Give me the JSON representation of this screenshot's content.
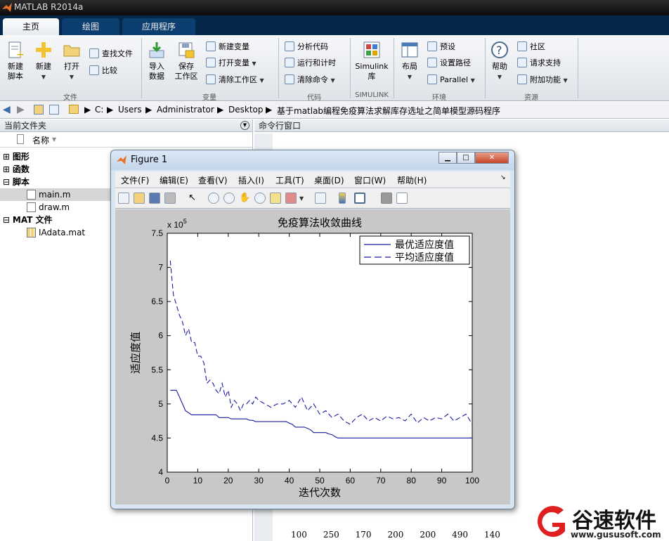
{
  "app": {
    "title": "MATLAB R2014a"
  },
  "tabs": [
    {
      "label": "主页"
    },
    {
      "label": "绘图"
    },
    {
      "label": "应用程序"
    }
  ],
  "ribbon": {
    "file": {
      "new_script": "新建\n脚本",
      "new": "新建",
      "open": "打开",
      "find_files": "查找文件",
      "compare": "比较",
      "group": "文件"
    },
    "variable": {
      "import": "导入\n数据",
      "save_ws": "保存\n工作区",
      "new_var": "新建变量",
      "open_var": "打开变量",
      "clear_ws": "清除工作区",
      "group": "变量"
    },
    "code": {
      "analyze": "分析代码",
      "run_time": "运行和计时",
      "clear_cmd": "清除命令",
      "group": "代码"
    },
    "simulink": {
      "label": "Simulink\n库",
      "group": "SIMULINK"
    },
    "env": {
      "layout": "布局",
      "prefs": "预设",
      "set_path": "设置路径",
      "parallel": "Parallel",
      "group": "环境"
    },
    "resources": {
      "help": "帮助",
      "community": "社区",
      "support": "请求支持",
      "addons": "附加功能",
      "group": "资源"
    }
  },
  "address": {
    "parts": [
      "C:",
      "Users",
      "Administrator",
      "Desktop",
      "基于matlab编程免疫算法求解库存选址之简单模型源码程序"
    ]
  },
  "left_panel": {
    "title": "当前文件夹",
    "col_name": "名称",
    "tree": [
      {
        "label": "图形"
      },
      {
        "label": "函数"
      },
      {
        "label": "脚本"
      },
      {
        "label": "main.m"
      },
      {
        "label": "draw.m"
      },
      {
        "label": "MAT 文件"
      },
      {
        "label": "IAdata.mat"
      }
    ]
  },
  "right_panel": {
    "title": "命令行窗口",
    "bottom_numbers": [
      "100",
      "250",
      "170",
      "200",
      "200",
      "490",
      "140"
    ]
  },
  "figure": {
    "title": "Figure 1",
    "menu": [
      "文件(F)",
      "编辑(E)",
      "查看(V)",
      "插入(I)",
      "工具(T)",
      "桌面(D)",
      "窗口(W)",
      "帮助(H)"
    ]
  },
  "watermark": {
    "text": "谷速软件",
    "url": "www.gususoft.com"
  },
  "chart_data": {
    "type": "line",
    "title": "免疫算法收敛曲线",
    "xlabel": "迭代次数",
    "ylabel": "适应度值",
    "y_exponent": "x 10^5",
    "xlim": [
      0,
      100
    ],
    "ylim": [
      4,
      7.5
    ],
    "x_ticks": [
      "0",
      "10",
      "20",
      "30",
      "40",
      "50",
      "60",
      "70",
      "80",
      "90",
      "100"
    ],
    "y_ticks": [
      "4",
      "4.5",
      "5",
      "5.5",
      "6",
      "6.5",
      "7",
      "7.5"
    ],
    "legend_position": "top-right",
    "series": [
      {
        "name": "最优适应度值",
        "style": "solid",
        "color": "#1a1aa0",
        "x": [
          1,
          3,
          4,
          5,
          6,
          8,
          10,
          11,
          12,
          13,
          14,
          15,
          16,
          17,
          18,
          19,
          20,
          21,
          22,
          23,
          24,
          25,
          26,
          27,
          28,
          29,
          30,
          31,
          32,
          33,
          34,
          35,
          36,
          37,
          38,
          39,
          40,
          41,
          42,
          43,
          44,
          45,
          46,
          47,
          48,
          49,
          50,
          51,
          52,
          53,
          54,
          55,
          56,
          57,
          58,
          59,
          60,
          65,
          70,
          75,
          80,
          85,
          90,
          95,
          100
        ],
        "y": [
          5.2,
          5.2,
          5.1,
          5.0,
          4.9,
          4.84,
          4.84,
          4.84,
          4.84,
          4.84,
          4.84,
          4.84,
          4.84,
          4.8,
          4.8,
          4.8,
          4.8,
          4.78,
          4.78,
          4.78,
          4.78,
          4.78,
          4.78,
          4.76,
          4.76,
          4.74,
          4.74,
          4.74,
          4.74,
          4.74,
          4.74,
          4.74,
          4.74,
          4.74,
          4.74,
          4.74,
          4.72,
          4.7,
          4.66,
          4.66,
          4.66,
          4.66,
          4.64,
          4.62,
          4.58,
          4.58,
          4.58,
          4.58,
          4.58,
          4.56,
          4.55,
          4.52,
          4.5,
          4.5,
          4.5,
          4.5,
          4.5,
          4.5,
          4.5,
          4.5,
          4.5,
          4.5,
          4.5,
          4.5,
          4.5
        ]
      },
      {
        "name": "平均适应度值",
        "style": "dashed",
        "color": "#1a1aa0",
        "x": [
          1,
          2,
          3,
          4,
          5,
          6,
          7,
          8,
          9,
          10,
          11,
          12,
          13,
          14,
          15,
          16,
          17,
          18,
          19,
          20,
          21,
          22,
          23,
          24,
          25,
          26,
          27,
          28,
          29,
          30,
          32,
          34,
          36,
          38,
          40,
          42,
          44,
          46,
          48,
          50,
          52,
          54,
          56,
          58,
          60,
          62,
          64,
          66,
          68,
          70,
          72,
          74,
          76,
          78,
          80,
          82,
          84,
          86,
          88,
          90,
          92,
          94,
          96,
          98,
          100
        ],
        "y": [
          7.1,
          6.6,
          6.45,
          6.3,
          6.2,
          6.0,
          6.1,
          5.9,
          5.9,
          5.7,
          5.7,
          5.6,
          5.3,
          5.35,
          5.3,
          5.2,
          5.15,
          5.3,
          5.1,
          5.2,
          4.95,
          5.05,
          5.0,
          4.9,
          5.0,
          5.0,
          5.05,
          5.0,
          5.1,
          5.05,
          5.0,
          4.95,
          5.0,
          5.0,
          5.05,
          4.95,
          5.1,
          4.9,
          5.0,
          4.85,
          4.9,
          4.8,
          4.85,
          4.75,
          4.7,
          4.8,
          4.85,
          4.75,
          4.8,
          4.75,
          4.82,
          4.78,
          4.8,
          4.75,
          4.85,
          4.72,
          4.8,
          4.75,
          4.8,
          4.78,
          4.85,
          4.75,
          4.8,
          4.85,
          4.7
        ]
      }
    ]
  }
}
